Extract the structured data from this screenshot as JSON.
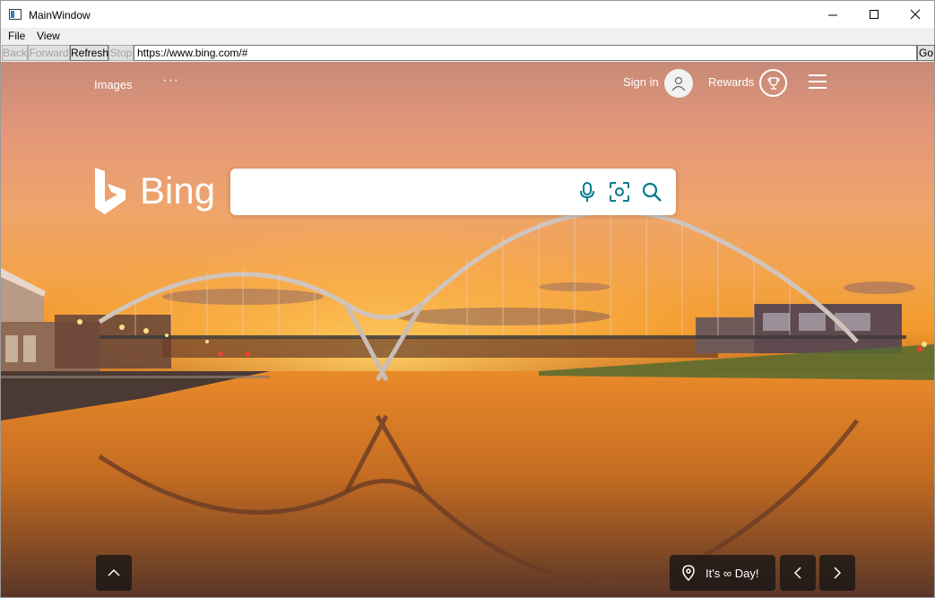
{
  "window": {
    "title": "MainWindow"
  },
  "menu": {
    "file": "File",
    "view": "View"
  },
  "nav": {
    "back": "Back",
    "forward": "Forward",
    "refresh": "Refresh",
    "stop": "Stop",
    "url": "https://www.bing.com/#",
    "go": "Go"
  },
  "bing": {
    "top_nav": {
      "images": "Images",
      "more": "···",
      "sign_in": "Sign in",
      "rewards": "Rewards"
    },
    "logo_text": "Bing",
    "search": {
      "value": "",
      "placeholder": ""
    },
    "footer": {
      "info": "It's ∞ Day!"
    }
  },
  "icons": [
    "app-icon",
    "minimize-icon",
    "maximize-icon",
    "close-icon",
    "user-icon",
    "trophy-icon",
    "hamburger-icon",
    "bing-logo-icon",
    "microphone-icon",
    "visual-search-icon",
    "search-icon",
    "chevron-up-icon",
    "location-pin-icon",
    "chevron-left-icon",
    "chevron-right-icon"
  ],
  "colors": {
    "accent": "#007c8a",
    "sky_top": "#c78a78",
    "sunset": "#f29a2c",
    "footer_btn": "#141414"
  }
}
